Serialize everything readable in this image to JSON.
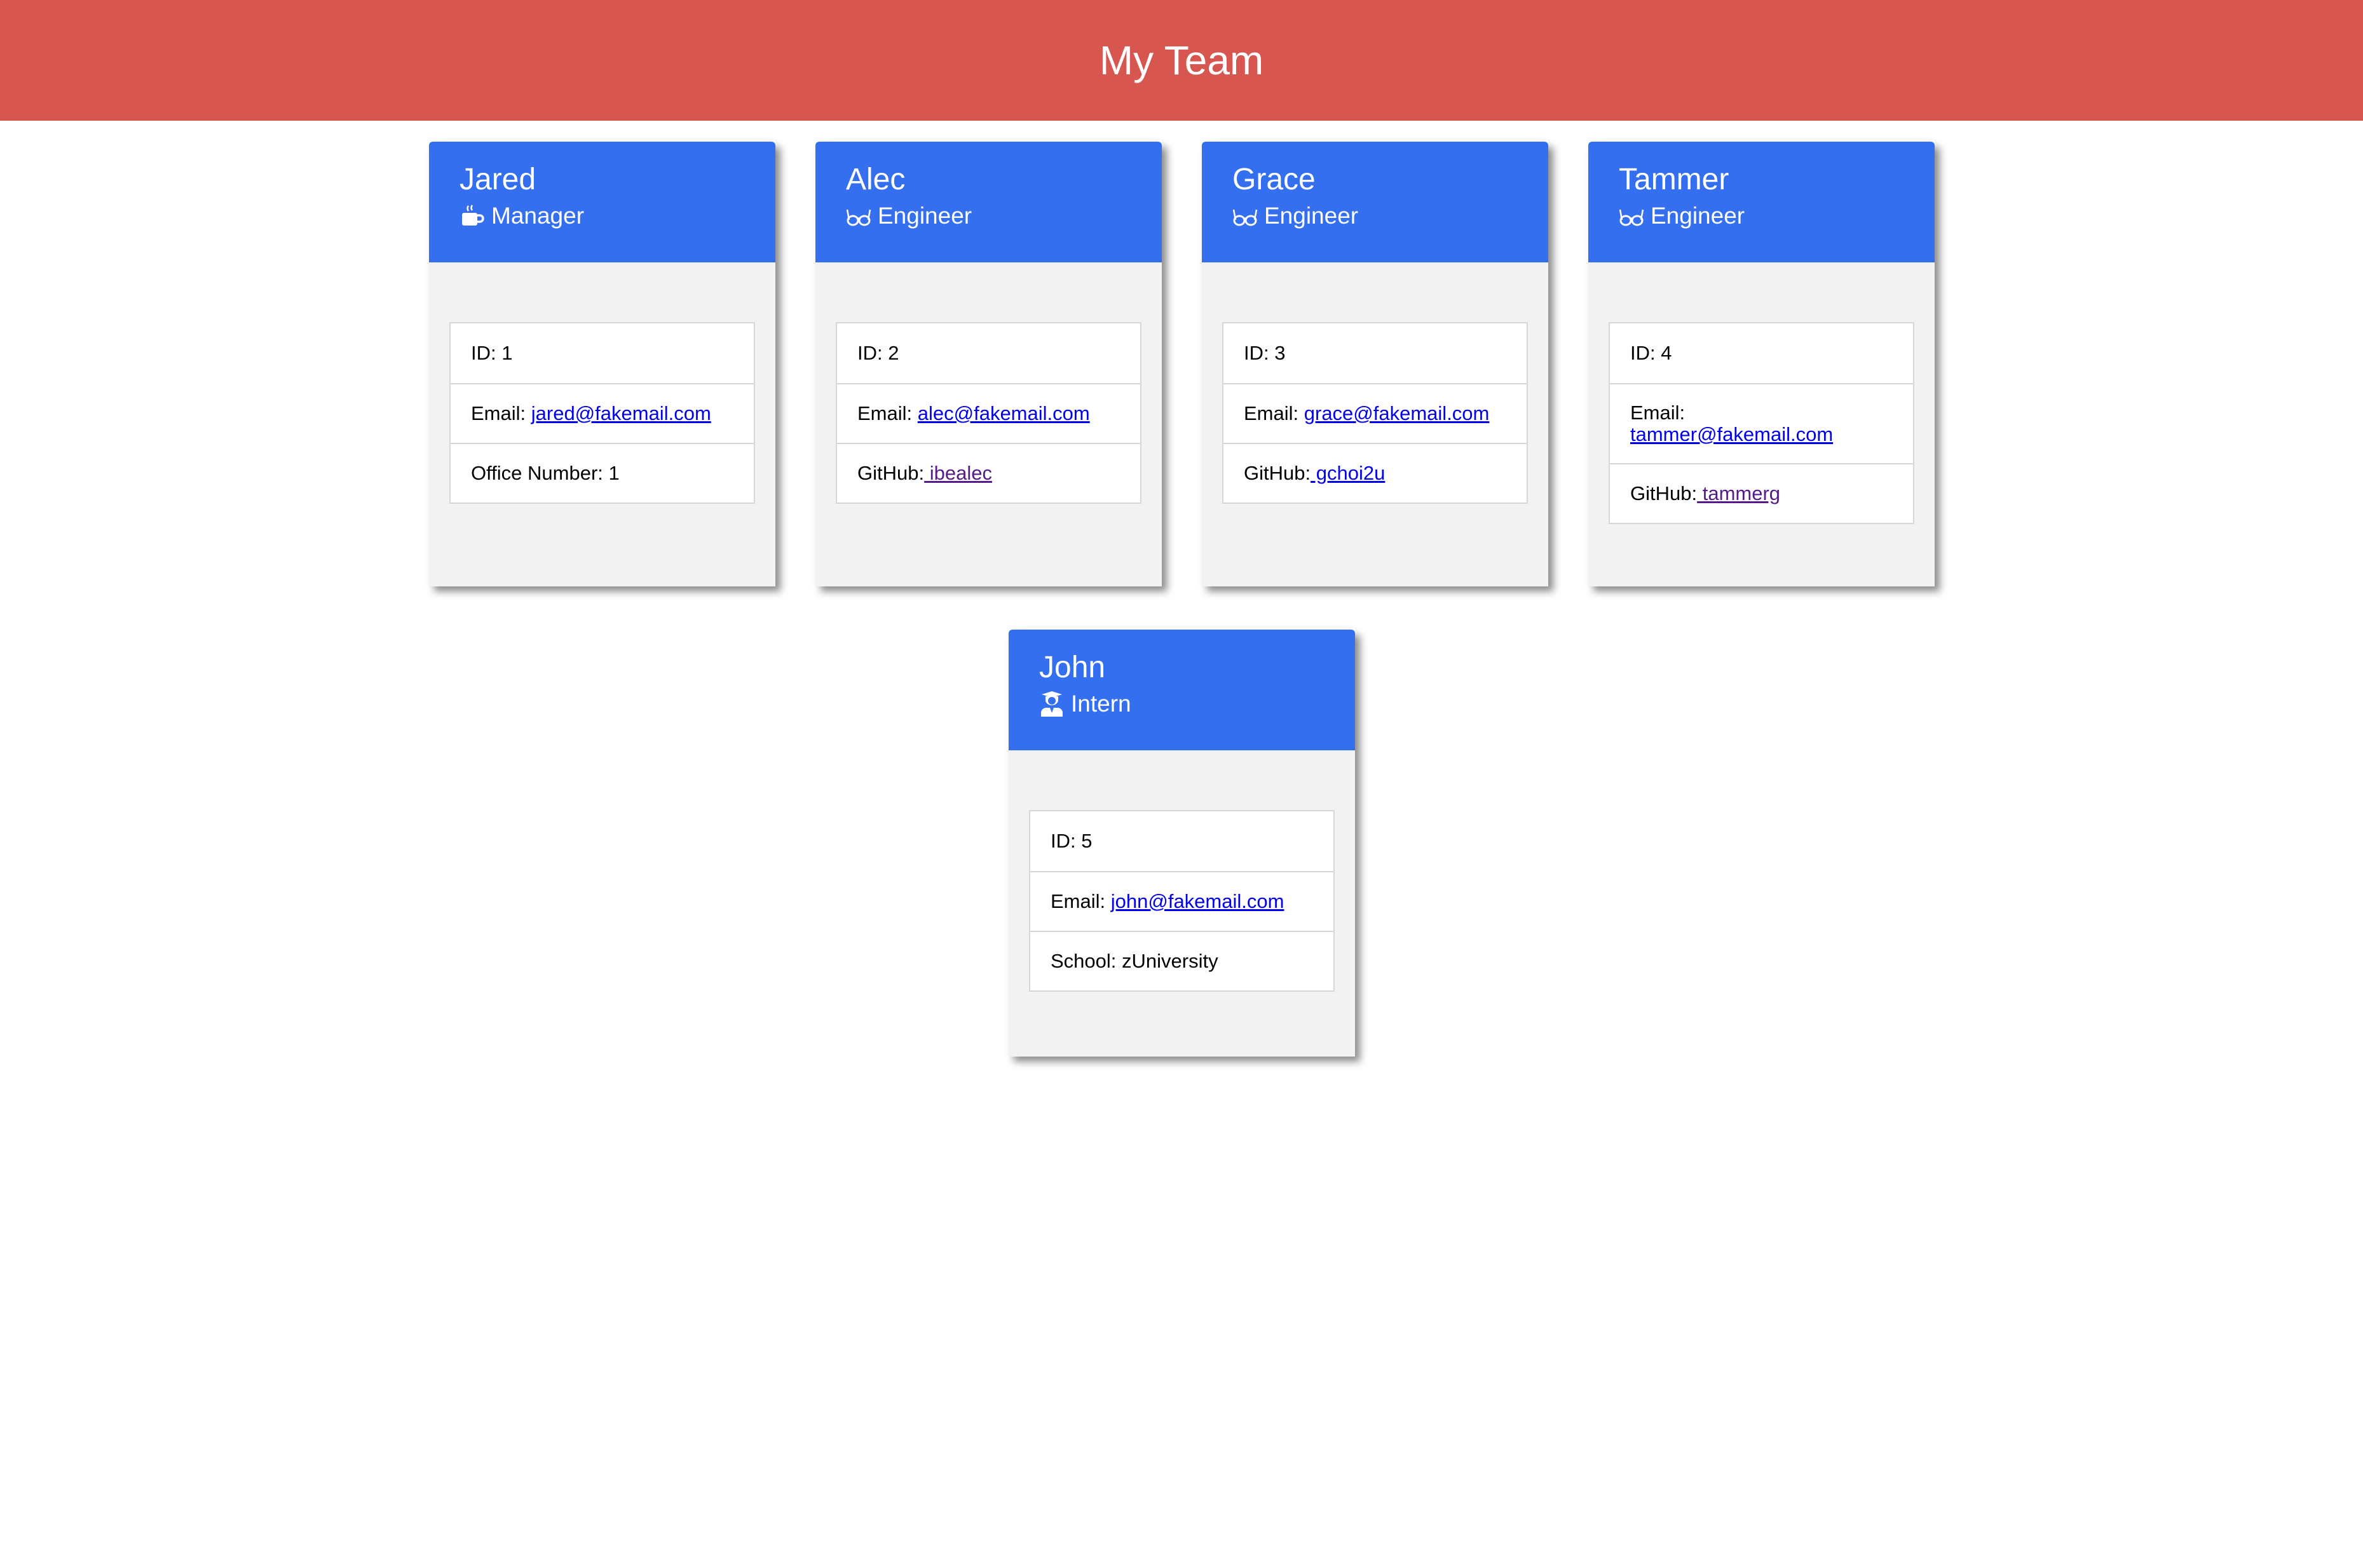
{
  "header": {
    "title": "My Team"
  },
  "team": [
    {
      "name": "Jared",
      "role": "Manager",
      "role_icon": "mug-icon",
      "id_label": "ID: 1",
      "email_prefix": "Email: ",
      "email": "jared@fakemail.com",
      "extra_label": "Office Number: 1"
    },
    {
      "name": "Alec",
      "role": "Engineer",
      "role_icon": "glasses-icon",
      "id_label": "ID: 2",
      "email_prefix": "Email: ",
      "email": "alec@fakemail.com",
      "extra_prefix": "GitHub:",
      "extra_link": " ibealec"
    },
    {
      "name": "Grace",
      "role": "Engineer",
      "role_icon": "glasses-icon",
      "id_label": "ID: 3",
      "email_prefix": "Email: ",
      "email": "grace@fakemail.com",
      "extra_prefix": "GitHub:",
      "extra_link": " gchoi2u"
    },
    {
      "name": "Tammer",
      "role": "Engineer",
      "role_icon": "glasses-icon",
      "id_label": "ID: 4",
      "email_prefix": "Email:",
      "email": "tammer@fakemail.com",
      "extra_prefix": "GitHub:",
      "extra_link": " tammerg"
    },
    {
      "name": "John",
      "role": "Intern",
      "role_icon": "graduate-icon",
      "id_label": "ID: 5",
      "email_prefix": "Email: ",
      "email": "john@fakemail.com",
      "extra_label": "School: zUniversity"
    }
  ],
  "colors": {
    "header_bg": "#d75650",
    "card_header_bg": "#346ff0",
    "card_body_bg": "#f2f2f2"
  }
}
